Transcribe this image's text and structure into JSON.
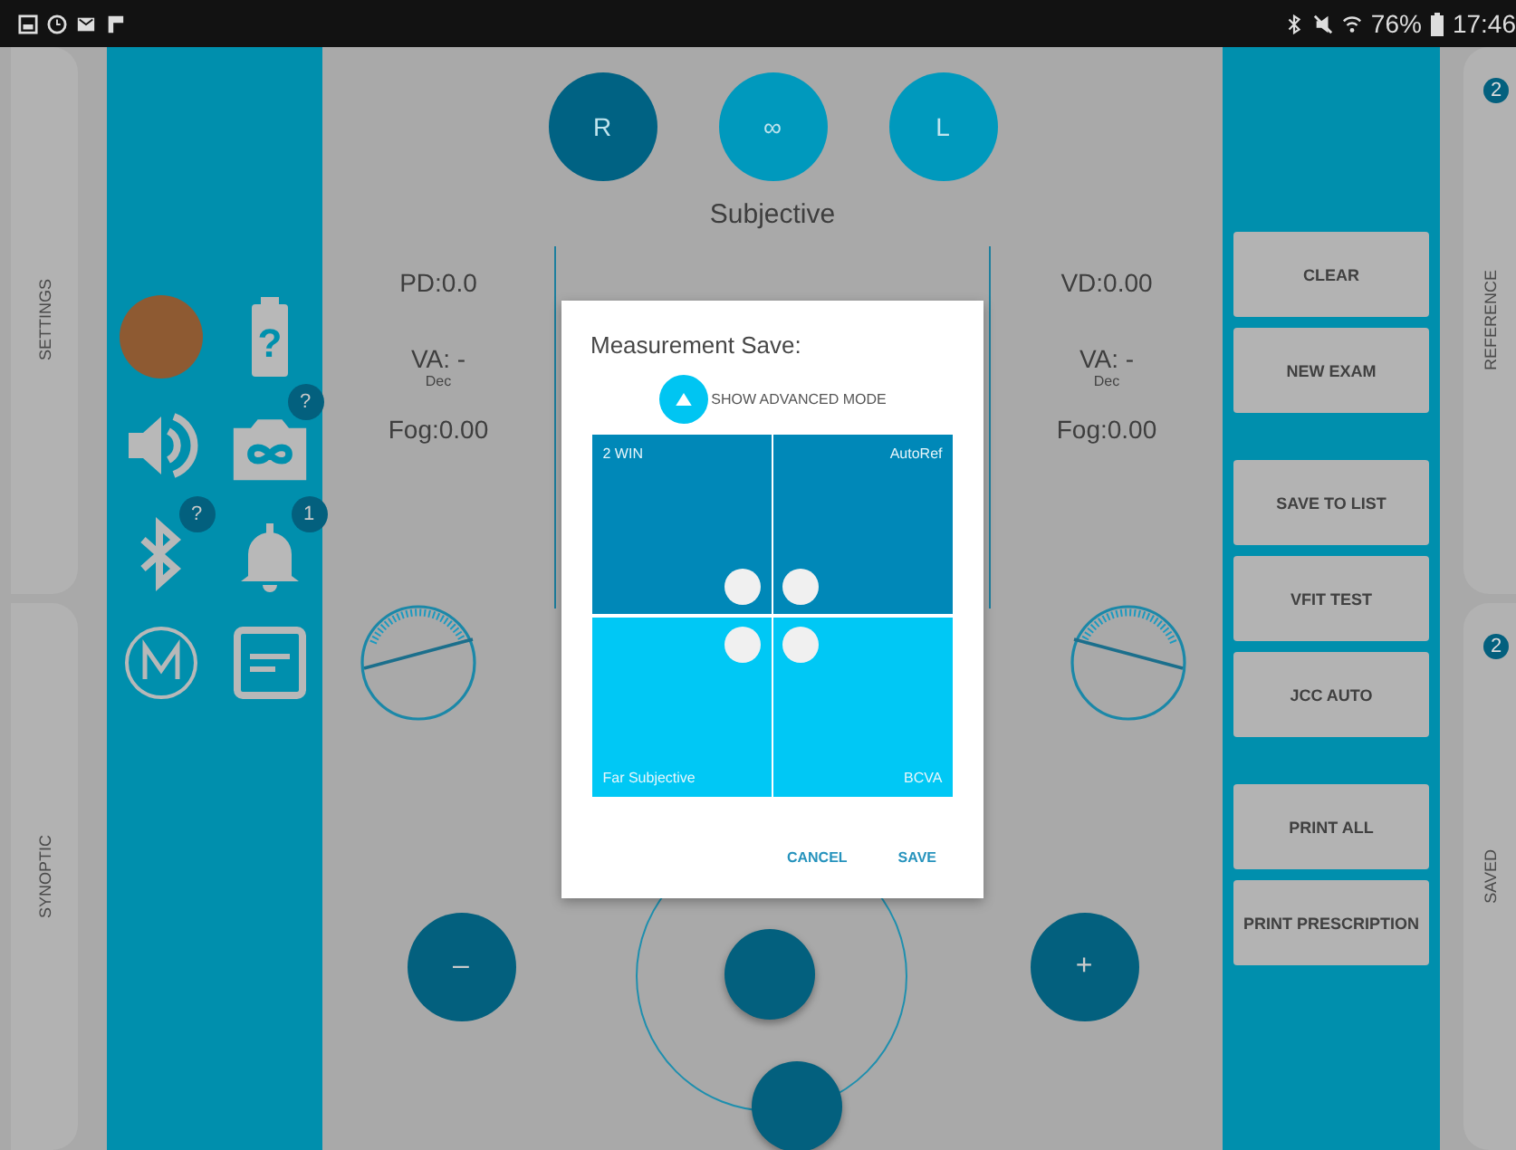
{
  "status_bar": {
    "battery": "76%",
    "time": "17:46"
  },
  "left_tabs": [
    {
      "label": "SETTINGS"
    },
    {
      "label": "SYNOPTIC"
    }
  ],
  "device_badges": {
    "battery": "?",
    "camera": "?",
    "bluetooth": "?",
    "bell": "1"
  },
  "eye_buttons": [
    {
      "label": "R",
      "selected": true
    },
    {
      "label": "∞",
      "selected": false
    },
    {
      "label": "L",
      "selected": false
    }
  ],
  "mode_title": "Subjective",
  "left_eye": {
    "distance": "PD:0.0",
    "va": "VA: -",
    "va_unit": "Dec",
    "fog": "Fog:0.00"
  },
  "right_eye": {
    "distance": "VD:0.00",
    "va": "VA: -",
    "va_unit": "Dec",
    "fog": "Fog:0.00"
  },
  "step_buttons": {
    "minus": "–",
    "plus": "+"
  },
  "action_groups": [
    [
      "CLEAR",
      "NEW EXAM"
    ],
    [
      "SAVE TO LIST",
      "VFIT TEST",
      "JCC AUTO"
    ],
    [
      "PRINT ALL",
      "PRINT PRESCRIPTION"
    ]
  ],
  "right_tabs": [
    {
      "label": "REFERENCE",
      "badge": "2"
    },
    {
      "label": "SAVED",
      "badge": "2"
    }
  ],
  "dialog": {
    "title": "Measurement Save:",
    "advanced_label": "SHOW ADVANCED MODE",
    "cells": [
      {
        "label": "2 WIN",
        "color": "#0088b8"
      },
      {
        "label": "AutoRef",
        "color": "#0088b8"
      },
      {
        "label": "Far Subjective",
        "color": "#00c8f5"
      },
      {
        "label": "BCVA",
        "color": "#00c8f5"
      }
    ],
    "buttons": [
      "CANCEL",
      "SAVE"
    ]
  }
}
